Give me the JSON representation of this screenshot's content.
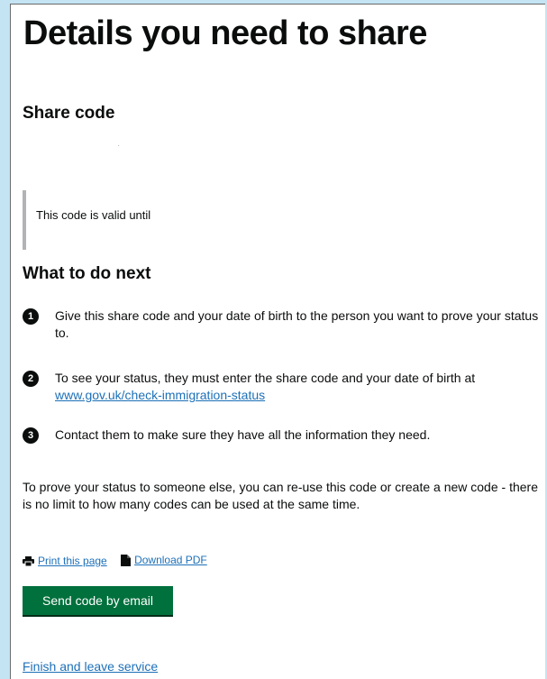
{
  "page": {
    "title": "Details you need to share"
  },
  "share_code": {
    "heading": "Share code",
    "value": "·"
  },
  "validity": {
    "text": "This code is valid until"
  },
  "next_steps": {
    "heading": "What to do next",
    "steps": [
      {
        "number": "1",
        "text": "Give this share code and your date of birth to the person you want to prove your status to."
      },
      {
        "number": "2",
        "text": "To see your status, they must enter the share code and your date of birth at ",
        "link_text": "www.gov.uk/check-immigration-status"
      },
      {
        "number": "3",
        "text": "Contact them to make sure they have all the information they need."
      }
    ]
  },
  "reuse_note": "To prove your status to someone else, you can re-use this code or create a new code - there is no limit to how many codes can be used at the same time.",
  "actions": {
    "print_label": "Print this page",
    "print_icon": "printer-icon",
    "download_label": "Download PDF",
    "download_icon": "document-icon"
  },
  "buttons": {
    "send_email_label": "Send code by email"
  },
  "links": {
    "finish_label": "Finish and leave service"
  },
  "colors": {
    "background": "#c5e4f3",
    "text": "#0b0c0c",
    "link": "#1d70b8",
    "button": "#00703c",
    "inset_border": "#b1b4b6"
  }
}
